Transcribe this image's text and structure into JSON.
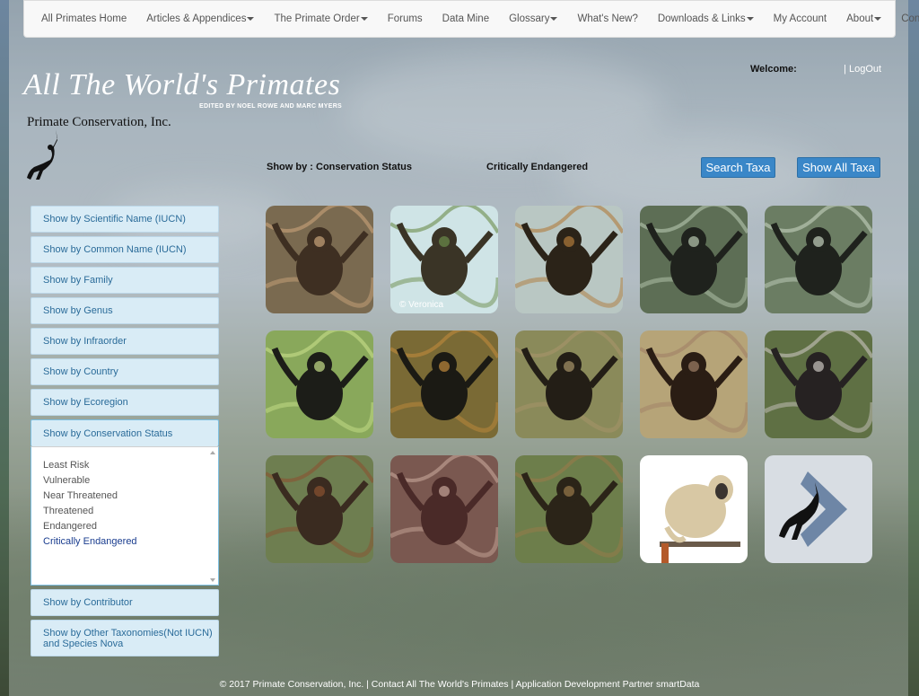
{
  "nav": {
    "items": [
      {
        "label": "All Primates Home",
        "dropdown": false
      },
      {
        "label": "Articles & Appendices",
        "dropdown": true
      },
      {
        "label": "The Primate Order",
        "dropdown": true
      },
      {
        "label": "Forums",
        "dropdown": false
      },
      {
        "label": "Data Mine",
        "dropdown": false
      },
      {
        "label": "Glossary",
        "dropdown": true
      },
      {
        "label": "What's New?",
        "dropdown": false
      },
      {
        "label": "Downloads & Links",
        "dropdown": true
      },
      {
        "label": "My Account",
        "dropdown": false
      },
      {
        "label": "About",
        "dropdown": true
      },
      {
        "label": "Contact Us",
        "dropdown": false
      }
    ]
  },
  "header": {
    "title": "All The World's Primates",
    "subtitle": "EDITED BY NOEL ROWE AND MARC MYERS",
    "org_name": "Primate Conservation, Inc.",
    "logo_icon": "monkey-silhouette-icon"
  },
  "user": {
    "welcome_label": "Welcome:",
    "separator": "|",
    "logout_label": "LogOut"
  },
  "filter": {
    "showby_label": "Show by : Conservation Status",
    "showby_value": "Critically Endangered",
    "search_button": "Search Taxa",
    "show_all_button": "Show All Taxa"
  },
  "sidebar": {
    "items": [
      "Show by Scientific Name (IUCN)",
      "Show by Common Name (IUCN)",
      "Show by Family",
      "Show by Genus",
      "Show by Infraorder",
      "Show by Country",
      "Show by Ecoregion",
      "Show by Conservation Status"
    ],
    "statuses": [
      "Least Risk",
      "Vulnerable",
      "Near Threatened",
      "Threatened",
      "Endangered",
      "Critically Endangered"
    ],
    "selected_status": "Critically Endangered",
    "after_items": [
      "Show by Contributor",
      "Show by Other Taxonomies(Not IUCN) and Species Nova"
    ]
  },
  "gallery": {
    "photos": [
      {
        "icon": "howler-monkey-photo",
        "bg": "#7a6a50",
        "fg": "#3e2f22",
        "accent": "#c9a47a"
      },
      {
        "icon": "spider-monkey-photo",
        "bg": "#cfe4e6",
        "fg": "#3a3426",
        "accent": "#6b8c4a",
        "caption": "© Veronica"
      },
      {
        "icon": "spider-monkey-photo",
        "bg": "#b9c7c3",
        "fg": "#2b2318",
        "accent": "#b07a3a"
      },
      {
        "icon": "spider-monkey-photo",
        "bg": "#5d6e55",
        "fg": "#1f221d",
        "accent": "#b8c8b0"
      },
      {
        "icon": "spider-monkey-photo",
        "bg": "#6b7d63",
        "fg": "#1f221d",
        "accent": "#c4d2bf"
      },
      {
        "icon": "spider-monkey-photo",
        "bg": "#89a85b",
        "fg": "#1c1d18",
        "accent": "#c8e08a"
      },
      {
        "icon": "spider-monkey-photo",
        "bg": "#7a6a35",
        "fg": "#1b1a14",
        "accent": "#c08a3c"
      },
      {
        "icon": "spider-monkey-photo",
        "bg": "#8a8a5a",
        "fg": "#231e16",
        "accent": "#a8946a"
      },
      {
        "icon": "spider-monkey-photo",
        "bg": "#b6a478",
        "fg": "#2a1d14",
        "accent": "#a08066"
      },
      {
        "icon": "spider-monkey-photo",
        "bg": "#5f7044",
        "fg": "#262222",
        "accent": "#c9c4bf"
      },
      {
        "icon": "spider-monkey-photo",
        "bg": "#6e7e50",
        "fg": "#3a2b20",
        "accent": "#8a5230"
      },
      {
        "icon": "spider-monkey-photo",
        "bg": "#7a5850",
        "fg": "#4a2a28",
        "accent": "#c7a79a"
      },
      {
        "icon": "spider-monkey-photo",
        "bg": "#6d7e4b",
        "fg": "#2b2418",
        "accent": "#9a7a4a"
      },
      {
        "icon": "titi-monkey-illustration",
        "bg": "#ffffff",
        "fg": "#d8c8a4",
        "accent": "#3a3430"
      },
      {
        "icon": "next-page-arrow-icon",
        "bg": "#d8dde3",
        "fg": "#6e86a6",
        "accent": "#111111"
      }
    ]
  },
  "footer": {
    "text": "© 2017 Primate Conservation, Inc. | Contact All The World's Primates | Application Development Partner smartData"
  }
}
